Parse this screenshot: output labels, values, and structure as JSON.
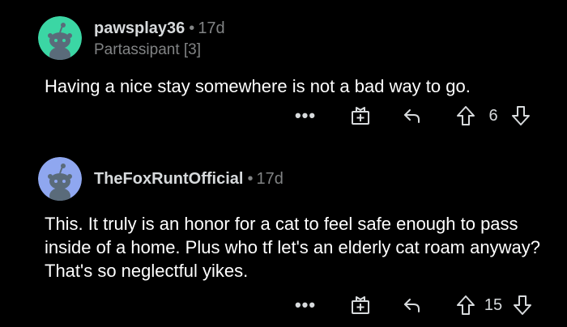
{
  "comments": [
    {
      "username": "pawsplay36",
      "separator": "•",
      "age": "17d",
      "flair": "Partassipant [3]",
      "avatar_color": "#3bd6a4",
      "body": "Having a nice stay somewhere is not a bad way to go.",
      "more_label": "•••",
      "score": "6"
    },
    {
      "username": "TheFoxRuntOfficial",
      "separator": "•",
      "age": "17d",
      "flair": "",
      "avatar_color": "#8fa7f0",
      "body": "This. It truly is an honor for a cat to feel safe enough to pass inside of a home.  Plus who tf let's an elderly cat roam anyway? That's so neglectful yikes.",
      "more_label": "•••",
      "score": "15"
    }
  ],
  "icons": {
    "more": "more-options-icon",
    "award": "award-gift-icon",
    "reply": "reply-arrow-icon",
    "upvote": "upvote-arrow-icon",
    "downvote": "downvote-arrow-icon",
    "avatar": "snoo-avatar-icon"
  },
  "colors": {
    "background": "#000000",
    "text_primary": "#ffffff",
    "text_secondary": "#818384"
  }
}
